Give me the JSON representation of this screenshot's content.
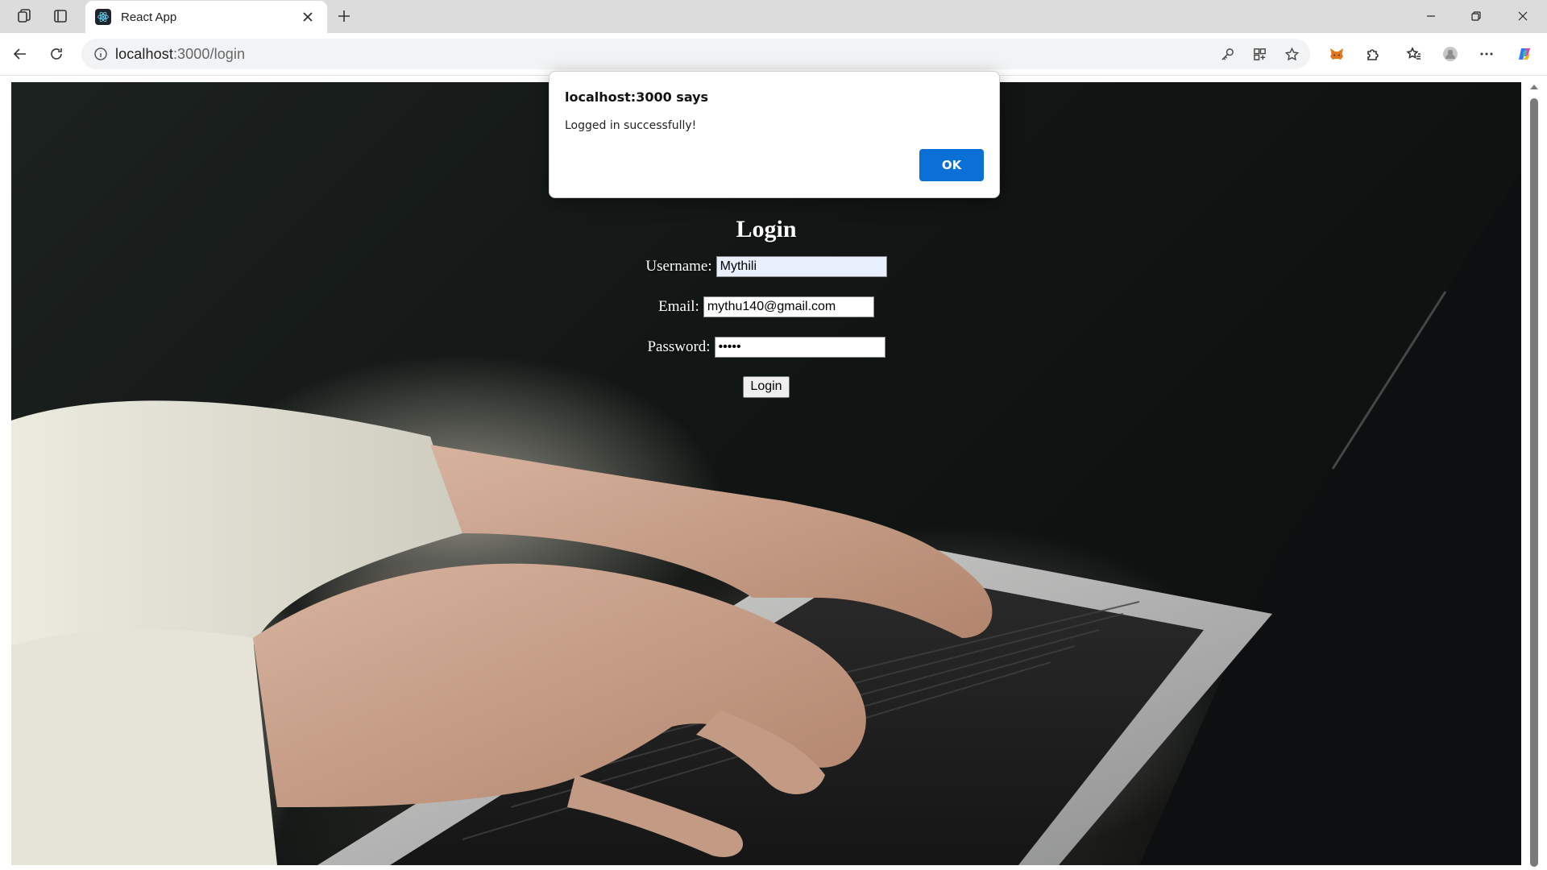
{
  "browser": {
    "tab_title": "React App",
    "url_host": "localhost",
    "url_rest": ":3000/login"
  },
  "page": {
    "heading": "Login",
    "username_label": "Username:",
    "username_value": "Mythili",
    "email_label": "Email:",
    "email_value": "mythu140@gmail.com",
    "password_label": "Password:",
    "password_value": "mythu",
    "login_button": "Login"
  },
  "alert": {
    "title": "localhost:3000 says",
    "message": "Logged in successfully!",
    "ok_label": "OK",
    "ok_color": "#0a6fd6"
  },
  "icons": {
    "workspaces": "workspaces-icon",
    "tab_actions": "tab-actions-icon",
    "favicon": "react-logo-icon",
    "back": "back-arrow-icon",
    "refresh": "refresh-icon",
    "site_info": "info-icon",
    "password_key": "key-icon",
    "apps": "apps-icon",
    "favorite": "star-icon",
    "metamask": "fox-icon",
    "extensions": "puzzle-icon",
    "favorites": "favorites-icon",
    "profile": "profile-icon",
    "menu": "more-icon",
    "copilot": "copilot-icon"
  }
}
